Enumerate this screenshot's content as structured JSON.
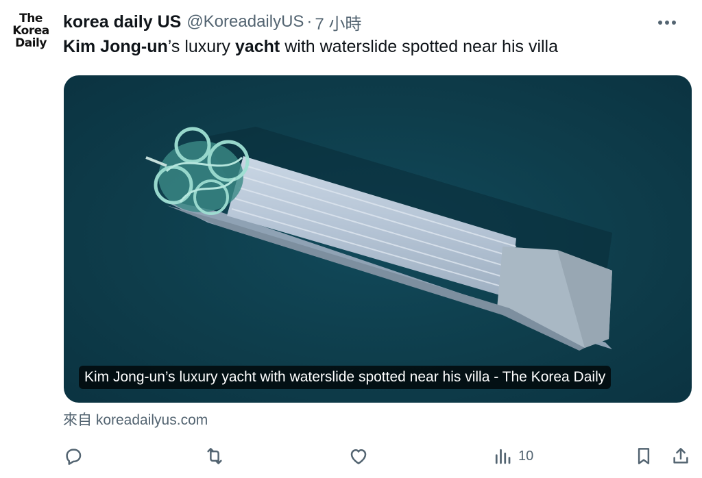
{
  "author": {
    "avatar_lines": [
      "The",
      "Korea",
      "Daily"
    ],
    "name": "korea daily US",
    "handle": "@KoreadailyUS",
    "separator": "·",
    "time": "7 小時"
  },
  "tweet": {
    "text_parts": [
      {
        "text": "Kim Jong-un",
        "bold": true
      },
      {
        "text": "’s luxury ",
        "bold": false
      },
      {
        "text": "yacht",
        "bold": true
      },
      {
        "text": " with waterslide spotted near his villa",
        "bold": false
      }
    ]
  },
  "card": {
    "caption": "Kim Jong-un’s luxury yacht with waterslide spotted near his villa - The Korea Daily",
    "source": "來自 koreadailyus.com"
  },
  "actions": {
    "reply_icon": "reply-icon",
    "retweet_icon": "retweet-icon",
    "like_icon": "heart-icon",
    "views_icon": "views-icon",
    "views_count": "10",
    "bookmark_icon": "bookmark-icon",
    "share_icon": "share-icon"
  },
  "colors": {
    "text": "#0f1419",
    "secondary": "#536471",
    "sea": "#0e3d4b"
  }
}
